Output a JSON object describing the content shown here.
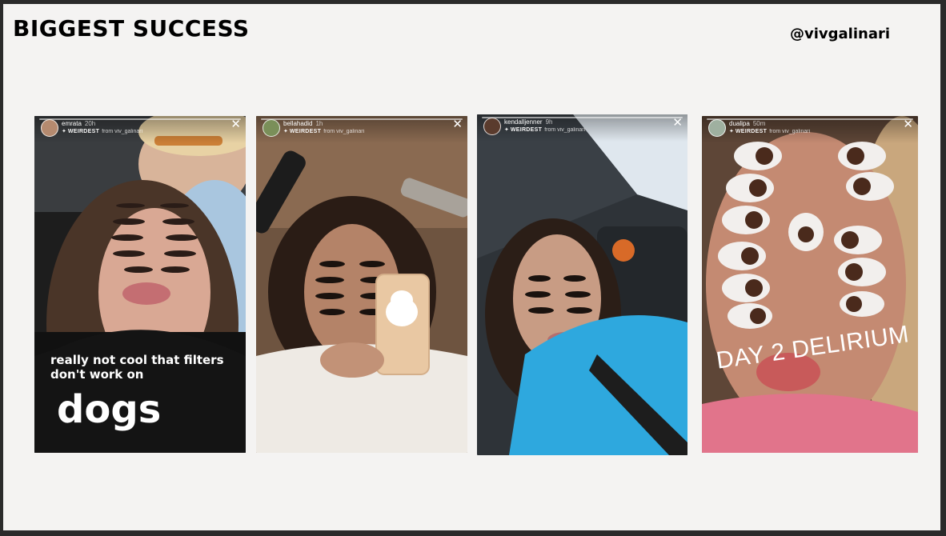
{
  "slide": {
    "title": "BIGGEST SUCCESS",
    "handle": "@vivgalinari"
  },
  "stories": [
    {
      "username": "emrata",
      "time": "20h",
      "effect": "WEIRDEST",
      "from": "from viv_galinari",
      "close_icon": "close-icon",
      "caption_small": "really not cool that filters don't work on",
      "caption_big": "dogs"
    },
    {
      "username": "bellahadid",
      "time": "1h",
      "effect": "WEIRDEST",
      "from": "from viv_galinari",
      "close_icon": "close-icon"
    },
    {
      "username": "kendalljenner",
      "time": "9h",
      "effect": "WEIRDEST",
      "from": "from viv_galinari",
      "close_icon": "close-icon"
    },
    {
      "username": "dualipa",
      "time": "50m",
      "effect": "WEIRDEST",
      "from": "from viv_galinari",
      "close_icon": "close-icon",
      "caption_big": "DAY 2 DELIRIUM"
    }
  ],
  "colors": {
    "slide_bg": "#f4f3f2",
    "frame": "#2b2b2b",
    "title_text": "#000000",
    "story_text": "#ffffff"
  }
}
